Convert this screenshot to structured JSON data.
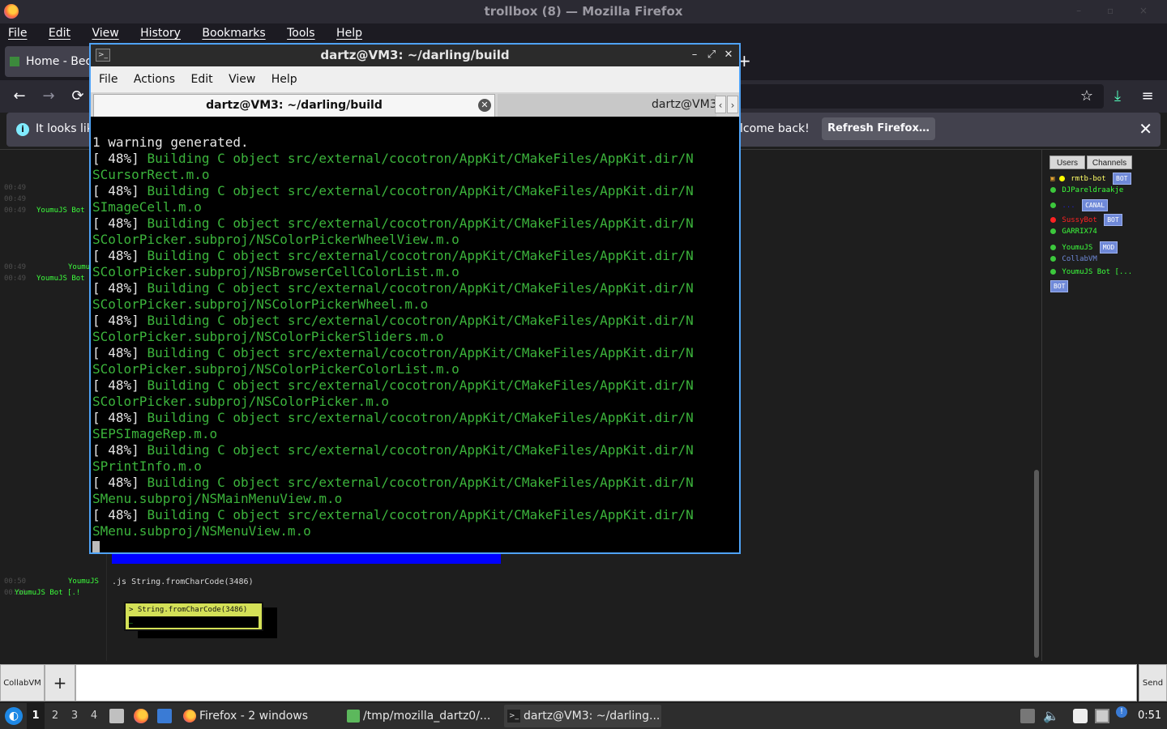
{
  "firefox": {
    "window_title": "trollbox (8) — Mozilla Firefox",
    "window_controls": "– ▫ ×",
    "menu": [
      "File",
      "Edit",
      "View",
      "History",
      "Bookmarks",
      "Tools",
      "Help"
    ],
    "tab_title": "Home - Bed",
    "new_tab": "+",
    "nav": {
      "back": "←",
      "forward": "→",
      "reload": "⟳",
      "star": "☆",
      "download": "⤓",
      "menu": "≡"
    },
    "notification": {
      "info_icon": "i",
      "text": "It looks lik",
      "welcome": "lcome back!",
      "refresh_button": "Refresh Firefox…",
      "close": "✕"
    }
  },
  "trollbox": {
    "chat_lines": [
      {
        "time": "00:49",
        "nick": ""
      },
      {
        "time": "00:49",
        "nick": ""
      },
      {
        "time": "00:49",
        "nick": "YoumuJS Bot"
      },
      {
        "time": "00:49",
        "nick": "Youmu"
      },
      {
        "time": "00:49",
        "nick": "YoumuJS Bot"
      },
      {
        "time": "00:50",
        "nick": "YoumuJS"
      },
      {
        "time": "00:50",
        "nick": "YoumuJS Bot [.!"
      }
    ],
    "message": ".js String.fromCharCode(3486)",
    "js_result": "> String.fromCharCode(3486)",
    "js_result_input": "_",
    "sidebar_tabs": [
      "Users",
      "Channels"
    ],
    "users": [
      {
        "name": "rmtb-bot",
        "color": "#ffff66",
        "dot": "#ffff00",
        "badge": "BOT"
      },
      {
        "name": "DJPareldraakje",
        "color": "#3cff3c",
        "dot": "#3cc83c",
        "badge": ""
      },
      {
        "name": "...",
        "color": "#2222cc",
        "dot": "#3cc83c",
        "badge": "CANAL"
      },
      {
        "name": "SussyBot",
        "color": "#ff2222",
        "dot": "#ff2222",
        "badge": "BOT"
      },
      {
        "name": "GARRIX74",
        "color": "#3cff3c",
        "dot": "#3cc83c",
        "badge": ""
      },
      {
        "name": "YoumuJS",
        "color": "#3cff3c",
        "dot": "#3cc83c",
        "badge": "MOD"
      },
      {
        "name": "CollabVM",
        "color": "#6f89d8",
        "dot": "#3cc83c",
        "badge": ""
      },
      {
        "name": "YoumuJS Bot [...",
        "color": "#3cff3c",
        "dot": "#3cc83c",
        "badge": ""
      }
    ],
    "last_badge": "BOT",
    "vm_button": "CollabVM",
    "plus_button": "+",
    "send_button": "Send"
  },
  "terminal": {
    "title": "dartz@VM3: ~/darling/build",
    "menu": [
      "File",
      "Actions",
      "Edit",
      "View",
      "Help"
    ],
    "tab1": "dartz@VM3: ~/darling/build",
    "tab2": "dartz@VM3:",
    "first_line": "1 warning generated.",
    "build_prefix": "[ 48%]",
    "build_action": "Building C object src/external/cocotron/AppKit/CMakeFiles/AppKit.dir/N",
    "continuations": [
      "SCursorRect.m.o",
      "SImageCell.m.o",
      "SColorPicker.subproj/NSColorPickerWheelView.m.o",
      "SColorPicker.subproj/NSBrowserCellColorList.m.o",
      "SColorPicker.subproj/NSColorPickerWheel.m.o",
      "SColorPicker.subproj/NSColorPickerSliders.m.o",
      "SColorPicker.subproj/NSColorPickerColorList.m.o",
      "SColorPicker.subproj/NSColorPicker.m.o",
      "SEPSImageRep.m.o",
      "SPrintInfo.m.o",
      "SMenu.subproj/NSMainMenuView.m.o",
      "SMenu.subproj/NSMenuView.m.o"
    ]
  },
  "taskbar": {
    "workspaces": [
      "1",
      "2",
      "3",
      "4"
    ],
    "tasks": [
      {
        "label": "Firefox - 2 windows",
        "active": false
      },
      {
        "label": "/tmp/mozilla_dartz0/...",
        "active": false
      },
      {
        "label": "dartz@VM3: ~/darling...",
        "active": true
      }
    ],
    "clock": "0:51"
  }
}
